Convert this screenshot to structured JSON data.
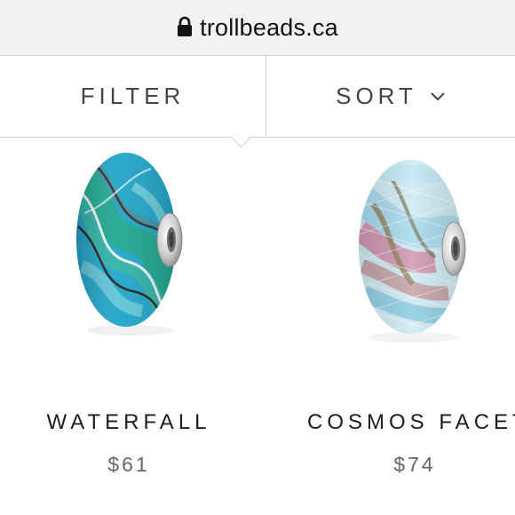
{
  "browser": {
    "domain": "trollbeads.ca"
  },
  "toolbar": {
    "filter_label": "FILTER",
    "sort_label": "SORT"
  },
  "products": [
    {
      "name": "WATERFALL",
      "price": "$61"
    },
    {
      "name": "COSMOS FACET",
      "price": "$74"
    }
  ],
  "colors": {
    "waterfall_primary": "#1aa3c7",
    "waterfall_secondary": "#19a58c",
    "cosmos_primary": "#a7d9ea",
    "cosmos_secondary": "#d07a98"
  }
}
